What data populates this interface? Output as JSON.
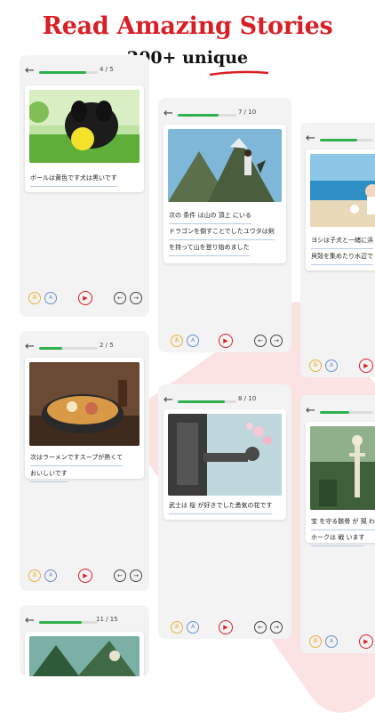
{
  "headline": "Read Amazing Stories",
  "subheadline": "200+ unique",
  "colors": {
    "accent": "#d91f26",
    "progress": "#2fb24e"
  },
  "icons": {
    "back": "←",
    "reading": "あ",
    "translate": "A",
    "play": "▶",
    "prev": "←",
    "next": "→"
  },
  "screens": [
    {
      "counter": "4 / 5",
      "progress": 0.8,
      "lines": [
        "ボールは黄色です犬は黒いです"
      ],
      "image": "black dog with yellow ball"
    },
    {
      "counter": "7 / 10",
      "progress": 0.7,
      "lines": [
        "次の 条件 は山の 頂上 にいる",
        "ドラゴンを倒すことでしたユウタは剣",
        "を持って山を登り始めました"
      ],
      "image": "boy on mountain with dragon"
    },
    {
      "counter": "",
      "progress": 0.6,
      "lines": [
        "ヨシは子犬と一緒に浜",
        "貝殻を集めたり水辺で"
      ],
      "image": "girl and puppy at beach"
    },
    {
      "counter": "2 / 5",
      "progress": 0.4,
      "lines": [
        "次はラーメンですスープが熱くて",
        "おいしいです"
      ],
      "image": "ramen bowl"
    },
    {
      "counter": "8 / 10",
      "progress": 0.8,
      "lines": [
        "武士は 桜 が好きでした勇気の花です"
      ],
      "image": "samurai armor with cherry blossom"
    },
    {
      "counter": "",
      "progress": 0.55,
      "lines": [
        "宝 を守る骸骨 が 現 わ",
        "ホークは 戦 います"
      ],
      "image": "skeleton in jungle"
    },
    {
      "counter": "11 / 15",
      "progress": 0.73,
      "lines": [],
      "image": "forest warrior"
    }
  ]
}
